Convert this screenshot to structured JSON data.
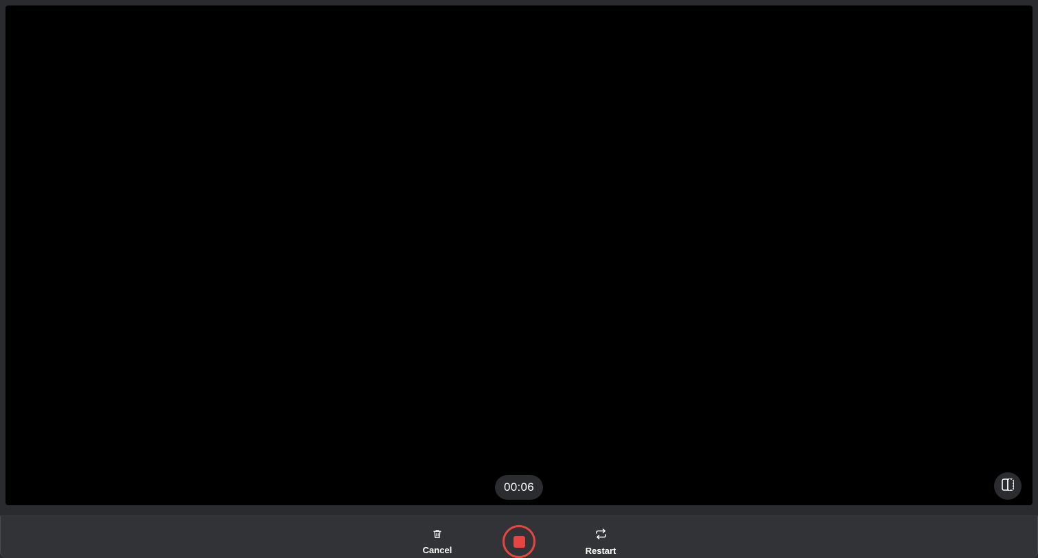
{
  "recorder": {
    "timer": "00:06",
    "split_view_icon": "split-view-icon"
  },
  "controls": {
    "cancel_label": "Cancel",
    "cancel_icon": "trash-icon",
    "restart_label": "Restart",
    "restart_icon": "repeat-icon",
    "stop_icon": "stop-icon"
  },
  "colors": {
    "accent": "#e5463f",
    "background": "#2a2b2f",
    "video": "#000000"
  }
}
